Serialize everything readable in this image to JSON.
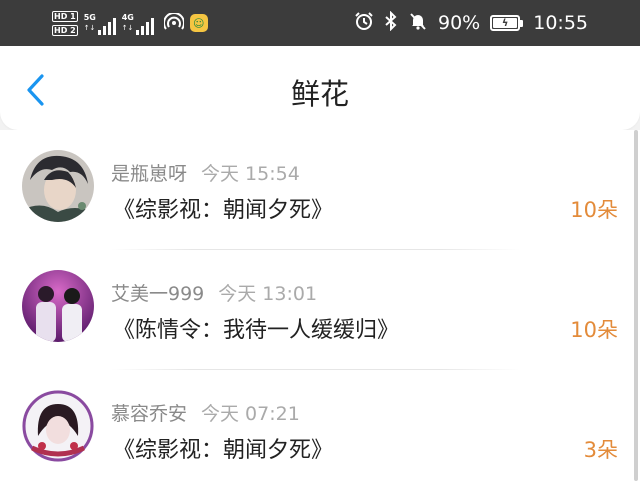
{
  "status_bar": {
    "sim1": "HD 1",
    "sim2": "HD 2",
    "net1": "5G",
    "net2": "4G",
    "battery_percent": "90%",
    "time": "10:55",
    "icons": [
      "alarm-icon",
      "bluetooth-icon",
      "mute-icon",
      "battery-icon",
      "hotspot-icon",
      "app-notification-icon"
    ]
  },
  "header": {
    "title": "鲜花",
    "back_icon": "chevron-left-icon"
  },
  "colors": {
    "accent": "#1a95f0",
    "count": "#e38b3a",
    "statusbar_bg": "#3c3c3c"
  },
  "flowers": [
    {
      "user": "是瓶崽呀",
      "time": "今天 15:54",
      "work": "《综影视：朝闻夕死》",
      "count": "10朵"
    },
    {
      "user": "艾美一999",
      "time": "今天 13:01",
      "work": "《陈情令：我待一人缓缓归》",
      "count": "10朵"
    },
    {
      "user": "慕容乔安",
      "time": "今天 07:21",
      "work": "《综影视：朝闻夕死》",
      "count": "3朵"
    }
  ]
}
